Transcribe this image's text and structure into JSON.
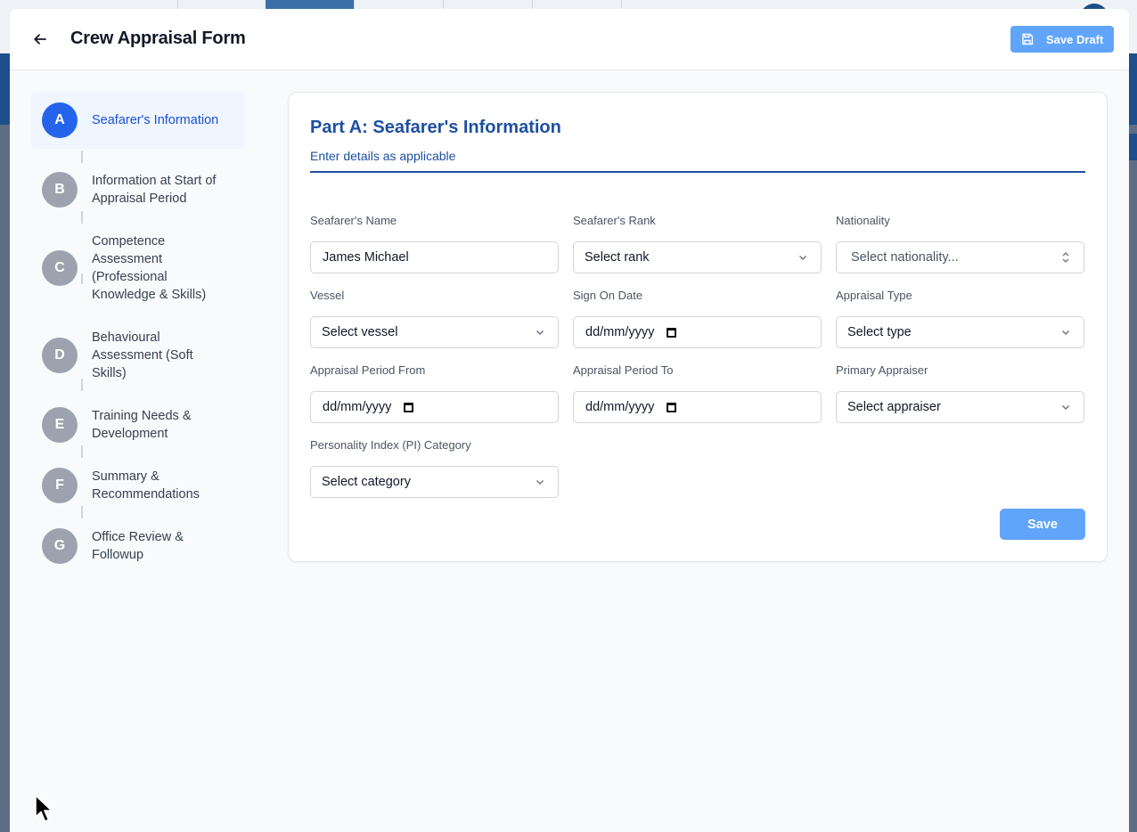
{
  "header": {
    "title": "Crew Appraisal Form",
    "save_draft_label": "Save Draft"
  },
  "steps": [
    {
      "letter": "A",
      "label": "Seafarer's Information",
      "active": true
    },
    {
      "letter": "B",
      "label": "Information at Start of Appraisal Period"
    },
    {
      "letter": "C",
      "label": "Competence Assessment (Professional Knowledge & Skills)"
    },
    {
      "letter": "D",
      "label": "Behavioural Assessment (Soft Skills)"
    },
    {
      "letter": "E",
      "label": "Training Needs & Development"
    },
    {
      "letter": "F",
      "label": "Summary & Recommendations"
    },
    {
      "letter": "G",
      "label": "Office Review & Followup"
    }
  ],
  "form": {
    "title": "Part A: Seafarer's Information",
    "subtitle": "Enter details as applicable",
    "fields": {
      "name": {
        "label": "Seafarer's Name",
        "value": "James Michael"
      },
      "rank": {
        "label": "Seafarer's Rank",
        "value": "Select rank"
      },
      "nationality": {
        "label": "Nationality",
        "value": "Select nationality..."
      },
      "vessel": {
        "label": "Vessel",
        "value": "Select vessel"
      },
      "sign_on": {
        "label": "Sign On Date",
        "value": "dd/mm/yyyy"
      },
      "appraisal_type": {
        "label": "Appraisal Type",
        "value": "Select type"
      },
      "period_from": {
        "label": "Appraisal Period From",
        "value": "dd/mm/yyyy"
      },
      "period_to": {
        "label": "Appraisal Period To",
        "value": "dd/mm/yyyy"
      },
      "primary_appraiser": {
        "label": "Primary Appraiser",
        "value": "Select appraiser"
      },
      "pi_category": {
        "label": "Personality Index (PI) Category",
        "value": "Select category"
      }
    },
    "save_label": "Save"
  },
  "icons": {
    "back": "arrow-left-icon",
    "save_draft": "floppy-disk-icon",
    "dropdown": "chevron-down-icon",
    "nationality": "chevron-up-down-icon",
    "date": "calendar-icon"
  },
  "colors": {
    "accent": "#2563eb",
    "heading": "#1e4fa1",
    "button": "#60a5fa"
  }
}
